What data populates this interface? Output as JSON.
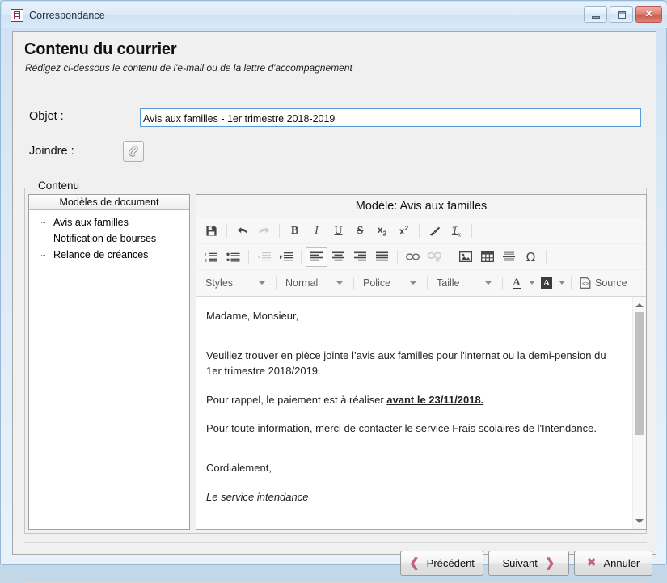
{
  "window": {
    "title": "Correspondance",
    "icon": "app-icon",
    "controls": {
      "minimize": "minimize",
      "maximize": "maximize",
      "close": "✕"
    }
  },
  "header": {
    "title": "Contenu du courrier",
    "subtitle": "Rédigez ci-dessous le contenu de l'e-mail ou de la lettre d'accompagnement"
  },
  "form": {
    "objet_label": "Objet :",
    "objet_value": "Avis aux familles - 1er trimestre 2018-2019",
    "objet_placeholder": "",
    "joindre_label": "Joindre :",
    "attach_icon": "paperclip-icon"
  },
  "content_group": {
    "legend": "Contenu"
  },
  "templates_panel": {
    "header": "Modèles de document",
    "items": [
      {
        "label": "Avis aux familles",
        "selected": true
      },
      {
        "label": "Notification de bourses",
        "selected": false
      },
      {
        "label": "Relance de créances",
        "selected": false
      }
    ]
  },
  "editor": {
    "title": "Modèle: Avis aux familles",
    "toolbar_row1": [
      {
        "name": "save-icon",
        "glyph": "save",
        "state": "normal"
      },
      {
        "name": "separator",
        "glyph": "sep",
        "state": "normal"
      },
      {
        "name": "undo-icon",
        "glyph": "undo",
        "state": "normal"
      },
      {
        "name": "redo-icon",
        "glyph": "redo",
        "state": "disabled"
      },
      {
        "name": "separator",
        "glyph": "sep",
        "state": "normal"
      },
      {
        "name": "bold-icon",
        "glyph": "B",
        "state": "normal"
      },
      {
        "name": "italic-icon",
        "glyph": "I",
        "state": "normal"
      },
      {
        "name": "underline-icon",
        "glyph": "U",
        "state": "normal"
      },
      {
        "name": "strikethrough-icon",
        "glyph": "S",
        "state": "normal"
      },
      {
        "name": "subscript-icon",
        "glyph": "x2sub",
        "state": "normal"
      },
      {
        "name": "superscript-icon",
        "glyph": "x2sup",
        "state": "normal"
      },
      {
        "name": "separator",
        "glyph": "sep",
        "state": "normal"
      },
      {
        "name": "remove-format-brush-icon",
        "glyph": "brush",
        "state": "normal"
      },
      {
        "name": "clear-formatting-icon",
        "glyph": "Tx",
        "state": "normal"
      },
      {
        "name": "separator",
        "glyph": "sep",
        "state": "normal"
      }
    ],
    "toolbar_row2": [
      {
        "name": "numbered-list-icon",
        "state": "normal"
      },
      {
        "name": "bulleted-list-icon",
        "state": "normal"
      },
      {
        "name": "separator",
        "state": "normal"
      },
      {
        "name": "decrease-indent-icon",
        "state": "disabled"
      },
      {
        "name": "increase-indent-icon",
        "state": "normal"
      },
      {
        "name": "separator",
        "state": "normal"
      },
      {
        "name": "align-left-icon",
        "state": "active"
      },
      {
        "name": "align-center-icon",
        "state": "normal"
      },
      {
        "name": "align-right-icon",
        "state": "normal"
      },
      {
        "name": "align-justify-icon",
        "state": "normal"
      },
      {
        "name": "separator",
        "state": "normal"
      },
      {
        "name": "insert-link-icon",
        "state": "normal"
      },
      {
        "name": "unlink-icon",
        "state": "disabled"
      },
      {
        "name": "separator",
        "state": "normal"
      },
      {
        "name": "insert-image-icon",
        "state": "normal"
      },
      {
        "name": "insert-table-icon",
        "state": "normal"
      },
      {
        "name": "horizontal-rule-icon",
        "state": "normal"
      },
      {
        "name": "special-character-icon",
        "state": "normal"
      },
      {
        "name": "separator",
        "state": "normal"
      }
    ],
    "toolbar_row3": {
      "styles_label": "Styles",
      "format_label": "Normal",
      "font_label": "Police",
      "size_label": "Taille",
      "text_color_icon": "text-color-icon",
      "background_color_icon": "background-color-icon",
      "source_label": "Source",
      "source_icon": "source-code-icon"
    },
    "document": {
      "paragraphs": [
        {
          "id": "p1",
          "text": "Madame, Monsieur,",
          "style": "normal",
          "spacing": "large"
        },
        {
          "id": "p2_part1",
          "text": "Veuillez trouver en pièce jointe l’avis aux familles pour l'internat ou la demi-pension du 1er trimestre 2018/2019.",
          "style": "normal",
          "spacing": "normal"
        },
        {
          "id": "p3_lead",
          "text": "Pour rappel, le paiement est à réaliser ",
          "style": "normal",
          "spacing": "normal"
        },
        {
          "id": "p3_emph",
          "text": "avant le 23/11/2018.",
          "style": "bold-underline",
          "spacing": "normal"
        },
        {
          "id": "p4",
          "text": "Pour toute information, merci de contacter le service Frais scolaires de l'Intendance.",
          "style": "normal",
          "spacing": "large"
        },
        {
          "id": "p5",
          "text": "Cordialement,",
          "style": "normal",
          "spacing": "normal"
        },
        {
          "id": "p6",
          "text": "Le service intendance",
          "style": "italic",
          "spacing": "normal"
        }
      ]
    },
    "scrollbar": {
      "up_arrow": "scroll-up",
      "down_arrow": "scroll-down",
      "thumb_position_percent": 6,
      "thumb_size_percent": 55
    }
  },
  "footer": {
    "previous_label": "Précédent",
    "previous_icon": "chevron-left-icon",
    "next_label": "Suivant",
    "next_icon": "chevron-right-icon",
    "cancel_label": "Annuler",
    "cancel_icon": "x-icon"
  },
  "colors": {
    "accent": "#c0628c",
    "window_chrome": "#cfe2f3",
    "client_bg": "#f0f0f0",
    "input_focus_border": "#5b9bd5",
    "close_button": "#cf5a4c"
  }
}
